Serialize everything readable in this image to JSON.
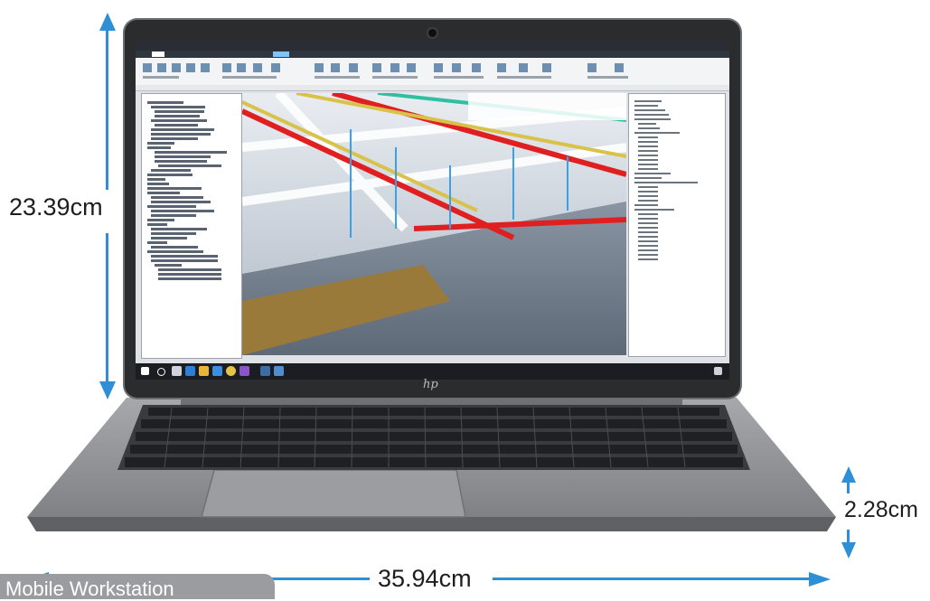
{
  "dimensions": {
    "height": "23.39cm",
    "width": "35.94cm",
    "thickness": "2.28cm"
  },
  "caption": "Mobile Workstation",
  "brand_logo": "hp",
  "colors": {
    "arrow": "#2e8fd6",
    "label_text": "#1e1e1e",
    "chassis": "#8e9094",
    "bezel": "#2b2c2e"
  }
}
